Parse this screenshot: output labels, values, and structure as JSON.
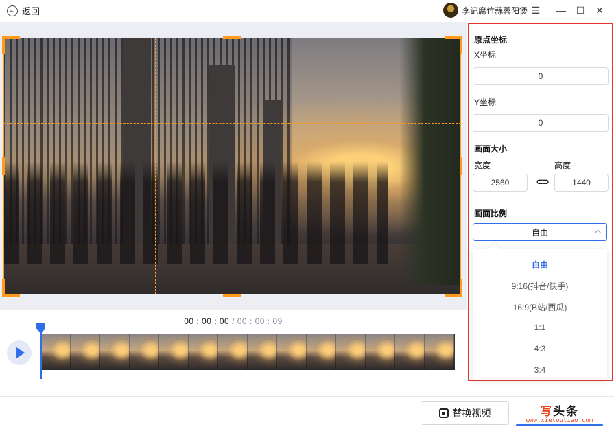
{
  "titlebar": {
    "back_label": "返回",
    "back_icon": "arrow-left-icon",
    "username": "李记腐竹蒜蓉阳煲",
    "menu_icon": "☰",
    "minimize_icon": "—",
    "maximize_icon": "☐",
    "close_icon": "✕"
  },
  "timeline": {
    "current_time": "00 : 00 : 00",
    "separator": " / ",
    "total_time": "00 : 00 : 09",
    "thumbnail_count": 14,
    "playhead_position": 0
  },
  "bottom": {
    "replace_label": "替换视频",
    "watermark_brand_a": "写",
    "watermark_brand_b": "头条",
    "watermark_url": "www.xietoutiao.com"
  },
  "panel": {
    "origin_title": "原点坐标",
    "x_label": "X坐标",
    "x_value": "0",
    "y_label": "Y坐标",
    "y_value": "0",
    "size_title": "画面大小",
    "width_label": "宽度",
    "width_value": "2560",
    "height_label": "高度",
    "height_value": "1440",
    "link_icon": "⊂⊃",
    "ratio_title": "画面比例",
    "ratio_selected": "自由",
    "ratio_options": [
      "自由",
      "9:16(抖音/快手)",
      "16:9(B站/西瓜)",
      "1:1",
      "4:3",
      "3:4"
    ]
  },
  "colors": {
    "accent": "#2f6ee8",
    "crop_guide": "#ff9a1a",
    "panel_border": "#e0392b"
  }
}
